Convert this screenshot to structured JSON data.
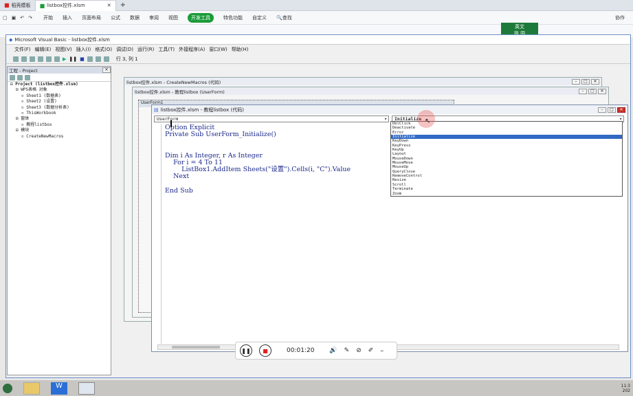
{
  "wps": {
    "tabs": [
      {
        "label": "稻壳模板"
      },
      {
        "label": "listbox控件.xlsm"
      }
    ],
    "menu": [
      "开始",
      "插入",
      "页面布局",
      "公式",
      "数据",
      "审阅",
      "视图",
      "开发工具",
      "特色功能",
      "自定义"
    ],
    "active_menu": "开发工具",
    "search_label": "查找",
    "collab_label": "协作",
    "ime": {
      "line1": "英文",
      "line2": "简 国"
    }
  },
  "vb": {
    "title": "Microsoft Visual Basic - listbox控件.xlsm",
    "menu": [
      "文件(F)",
      "编辑(E)",
      "视图(V)",
      "插入(I)",
      "格式(O)",
      "调试(D)",
      "运行(R)",
      "工具(T)",
      "外接程序(A)",
      "窗口(W)",
      "帮助(H)"
    ],
    "position": "行 3, 列 1",
    "project_title": "工程 - Project",
    "tree": [
      {
        "text": "Project (listbox控件.xlsm)",
        "indent": 0
      },
      {
        "text": "WPS表格 对象",
        "indent": 1
      },
      {
        "text": "Sheet1 (数据表)",
        "indent": 2
      },
      {
        "text": "Sheet2 (设置)",
        "indent": 2
      },
      {
        "text": "Sheet3 (数据分析表)",
        "indent": 2
      },
      {
        "text": "ThisWorkbook",
        "indent": 2
      },
      {
        "text": "窗体",
        "indent": 1
      },
      {
        "text": "教程listbox",
        "indent": 2
      },
      {
        "text": "模块",
        "indent": 1
      },
      {
        "text": "CreateNewMacros",
        "indent": 2
      }
    ],
    "win_macros_title": "listbox控件.xlsm - CreateNewMacros (代码)",
    "win_userform_title": "listbox控件.xlsm - 教程listbox (UserForm)",
    "userform_label": "UserForm1",
    "code_title": "listbox控件.xlsm - 教程listbox (代码)",
    "object_combo": "UserForm",
    "proc_combo": "Initialize",
    "code_lines": [
      "Option Explicit",
      "Private Sub UserForm_Initialize()",
      "",
      "",
      "Dim i As Integer, r As Integer",
      "    For i = 4 To 11",
      "        ListBox1.AddItem Sheets(\"设置\").Cells(i, \"C\").Value",
      "    Next",
      "",
      "End Sub"
    ],
    "dropdown": [
      "DblClick",
      "Deactivate",
      "Error",
      "Initialize",
      "KeyDown",
      "KeyPress",
      "KeyUp",
      "Layout",
      "MouseDown",
      "MouseMove",
      "MouseUp",
      "QueryClose",
      "RemoveControl",
      "Resize",
      "Scroll",
      "Terminate",
      "Zoom"
    ],
    "dropdown_selected": "Initialize"
  },
  "recorder": {
    "time": "00:01:20"
  },
  "taskbar": {
    "clock": "11:3",
    "date": "202"
  }
}
